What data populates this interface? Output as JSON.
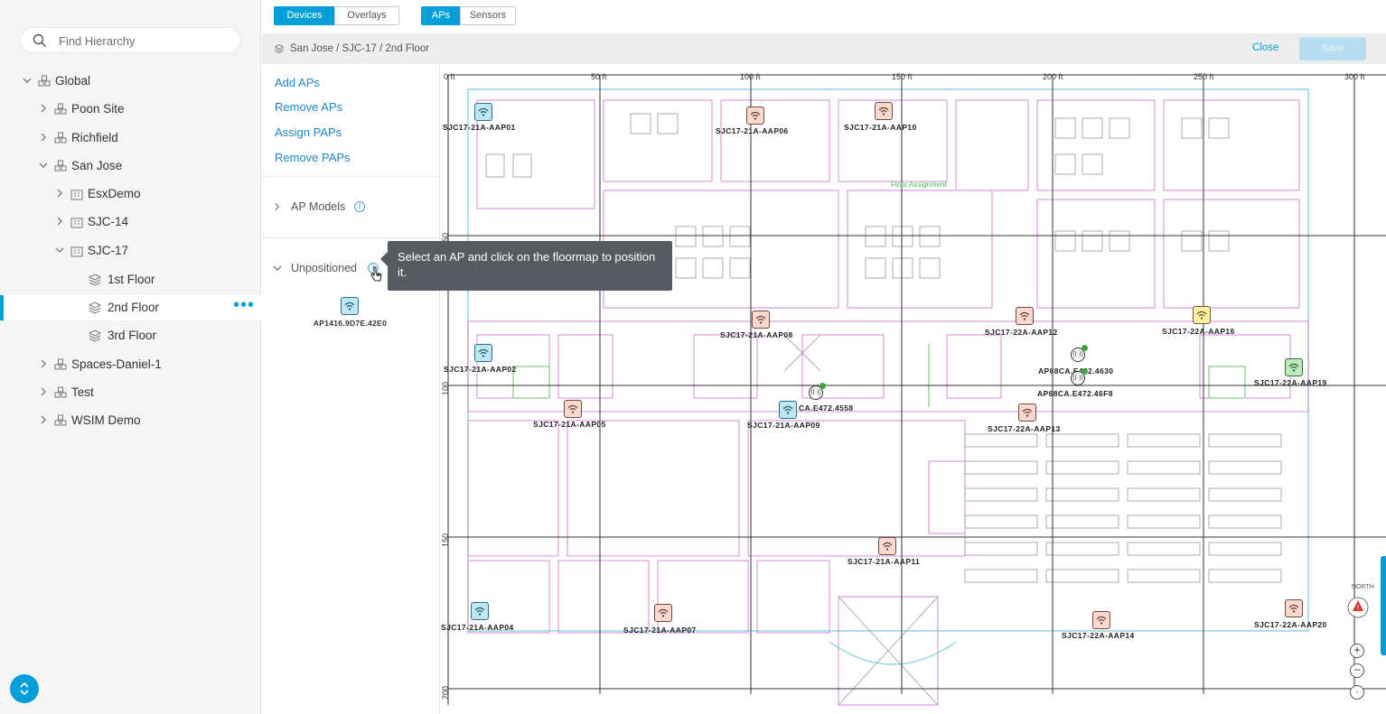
{
  "search": {
    "placeholder": "Find Hierarchy"
  },
  "tree": [
    {
      "label": "Global"
    },
    {
      "label": "Poon Site"
    },
    {
      "label": "Richfield"
    },
    {
      "label": "San Jose"
    },
    {
      "label": "EsxDemo"
    },
    {
      "label": "SJC-14"
    },
    {
      "label": "SJC-17"
    },
    {
      "label": "1st Floor"
    },
    {
      "label": "2nd Floor",
      "more": "•••"
    },
    {
      "label": "3rd Floor"
    },
    {
      "label": "Spaces-Daniel-1"
    },
    {
      "label": "Test"
    },
    {
      "label": "WSIM Demo"
    }
  ],
  "toolbar": {
    "tabs1": [
      {
        "label": "Devices"
      },
      {
        "label": "Overlays"
      }
    ],
    "tabs2": [
      {
        "label": "APs"
      },
      {
        "label": "Sensors"
      }
    ]
  },
  "breadcrumb": "San Jose / SJC-17 / 2nd Floor",
  "actions": {
    "close": "Close",
    "save": "Save"
  },
  "panel": {
    "links": [
      "Add APs",
      "Remove APs",
      "Assign PAPs",
      "Remove PAPs"
    ],
    "ap_models": "AP Models",
    "unpositioned": "Unpositioned",
    "unpositioned_ap": "AP1416.9D7E.42E0"
  },
  "tooltip": "Select an AP and click on the floormap to position it.",
  "ruler": {
    "top": [
      "0 ft",
      "50 ft",
      "100 ft",
      "150 ft",
      "200 ft",
      "250 ft",
      "300 ft"
    ],
    "left": [
      "50",
      "100",
      "150",
      "200"
    ]
  },
  "map_texts": {
    "floor_assignment": "Floor Assignment",
    "north": "NORTH"
  },
  "aps": [
    {
      "name": "SJC17-21A-AAP01",
      "color": "blue"
    },
    {
      "name": "SJC17-21A-AAP06",
      "color": "peach"
    },
    {
      "name": "SJC17-21A-AAP10",
      "color": "peach"
    },
    {
      "name": "SJC17-21A-AAP08",
      "color": "peach"
    },
    {
      "name": "SJC17-22A-AAP12",
      "color": "peach"
    },
    {
      "name": "SJC17-22A-AAP16",
      "color": "yellow"
    },
    {
      "name": "SJC17-21A-AAP02",
      "color": "blue"
    },
    {
      "name": "SJC17-22A-AAP19",
      "color": "green"
    },
    {
      "name": "SJC17-21A-AAP05",
      "color": "peach"
    },
    {
      "name": "SJC17-21A-AAP09",
      "color": "blue"
    },
    {
      "name": "SJC17-22A-AAP13",
      "color": "peach"
    },
    {
      "name": "SJC17-21A-AAP11",
      "color": "peach"
    },
    {
      "name": "SJC17-21A-AAP04",
      "color": "blue"
    },
    {
      "name": "SJC17-21A-AAP07",
      "color": "peach"
    },
    {
      "name": "SJC17-22A-AAP14",
      "color": "peach"
    },
    {
      "name": "SJC17-22A-AAP20",
      "color": "peach"
    }
  ],
  "sensors": [
    {
      "name": "AP68CA.E472.4630"
    },
    {
      "name": "AP68CA.E472.46F8"
    },
    {
      "name": "CA.E472.4558"
    }
  ],
  "colors": {
    "accent": "#049fd9",
    "ap_blue": "#bde7f5",
    "ap_peach": "#fbd9cf",
    "ap_yellow": "#fdf0a6",
    "ap_green": "#bfe9bf"
  }
}
